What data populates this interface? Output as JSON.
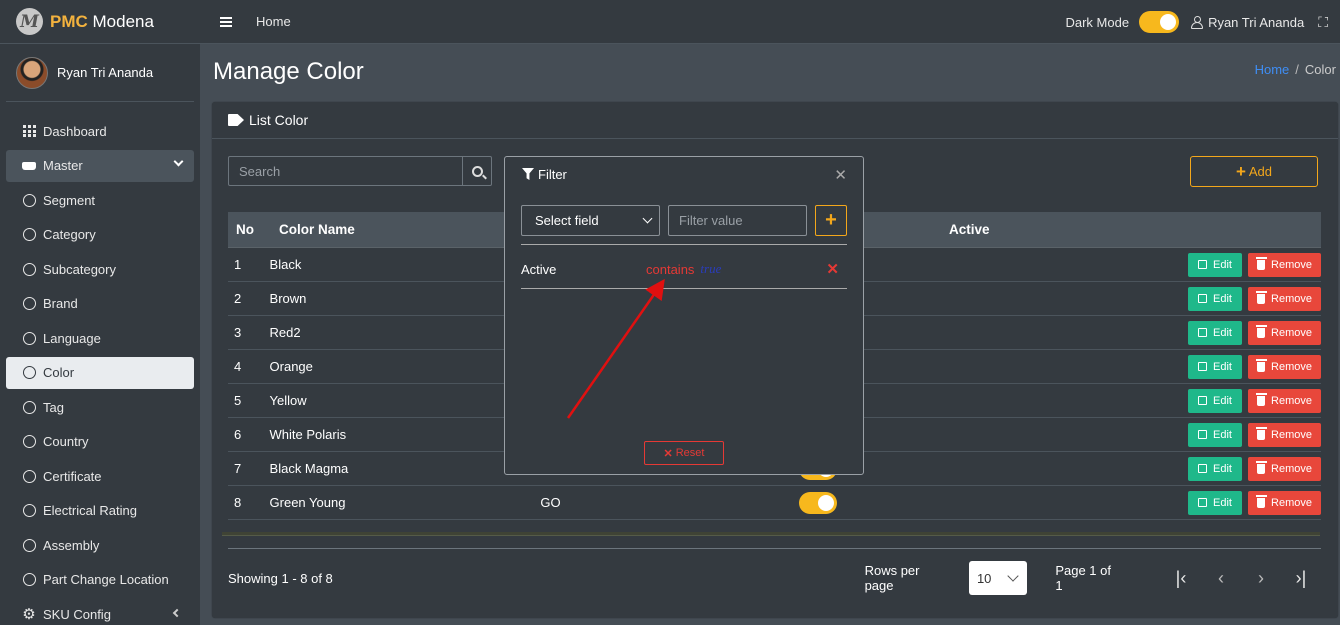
{
  "brand": {
    "logo_letter": "M",
    "name_bold": "PMC",
    "name_rest": " Modena"
  },
  "sidebar": {
    "user_name": "Ryan Tri Ananda",
    "items": [
      {
        "label": "Dashboard",
        "icon": "grid-icon"
      },
      {
        "label": "Master",
        "icon": "hdd-icon"
      },
      {
        "label": "Segment",
        "icon": "circle-icon"
      },
      {
        "label": "Category",
        "icon": "circle-icon"
      },
      {
        "label": "Subcategory",
        "icon": "circle-icon"
      },
      {
        "label": "Brand",
        "icon": "circle-icon"
      },
      {
        "label": "Language",
        "icon": "circle-icon"
      },
      {
        "label": "Color",
        "icon": "circle-icon"
      },
      {
        "label": "Tag",
        "icon": "circle-icon"
      },
      {
        "label": "Country",
        "icon": "circle-icon"
      },
      {
        "label": "Certificate",
        "icon": "circle-icon"
      },
      {
        "label": "Electrical Rating",
        "icon": "circle-icon"
      },
      {
        "label": "Assembly",
        "icon": "circle-icon"
      },
      {
        "label": "Part Change Location",
        "icon": "circle-icon"
      },
      {
        "label": "SKU Config",
        "icon": "gear-icon"
      }
    ]
  },
  "topbar": {
    "home": "Home",
    "dark_mode_label": "Dark Mode",
    "dark_mode_on": true,
    "user_name": "Ryan Tri Ananda"
  },
  "header": {
    "title": "Manage Color",
    "breadcrumb": [
      "Home",
      "Color"
    ]
  },
  "card": {
    "title": "List Color",
    "search_placeholder": "Search",
    "add_label": "Add",
    "columns": [
      "No",
      "Color Name",
      "",
      "Active",
      ""
    ],
    "rows": [
      {
        "no": "1",
        "name": "Black",
        "code": ""
      },
      {
        "no": "2",
        "name": "Brown",
        "code": ""
      },
      {
        "no": "3",
        "name": "Red2",
        "code": ""
      },
      {
        "no": "4",
        "name": "Orange",
        "code": ""
      },
      {
        "no": "5",
        "name": "Yellow",
        "code": ""
      },
      {
        "no": "6",
        "name": "White Polaris",
        "code": ""
      },
      {
        "no": "7",
        "name": "Black Magma",
        "code": ""
      },
      {
        "no": "8",
        "name": "Green Young",
        "code": "GO"
      }
    ],
    "edit_label": "Edit",
    "remove_label": "Remove",
    "showing": "Showing 1 - 8 of 8",
    "rows_per_page_label": "Rows per page",
    "rows_per_page": "10",
    "page_of": "Page 1 of 1"
  },
  "filter": {
    "title": "Filter",
    "select_field": "Select field",
    "value_placeholder": "Filter value",
    "rule": {
      "field": "Active",
      "operator": "contains",
      "value": "true"
    },
    "reset_label": "Reset"
  },
  "colors": {
    "accent": "#f7b81d",
    "edit": "#1fb88a",
    "remove": "#e8473b",
    "link": "#3f8ef5",
    "annotation": "#e01010"
  }
}
